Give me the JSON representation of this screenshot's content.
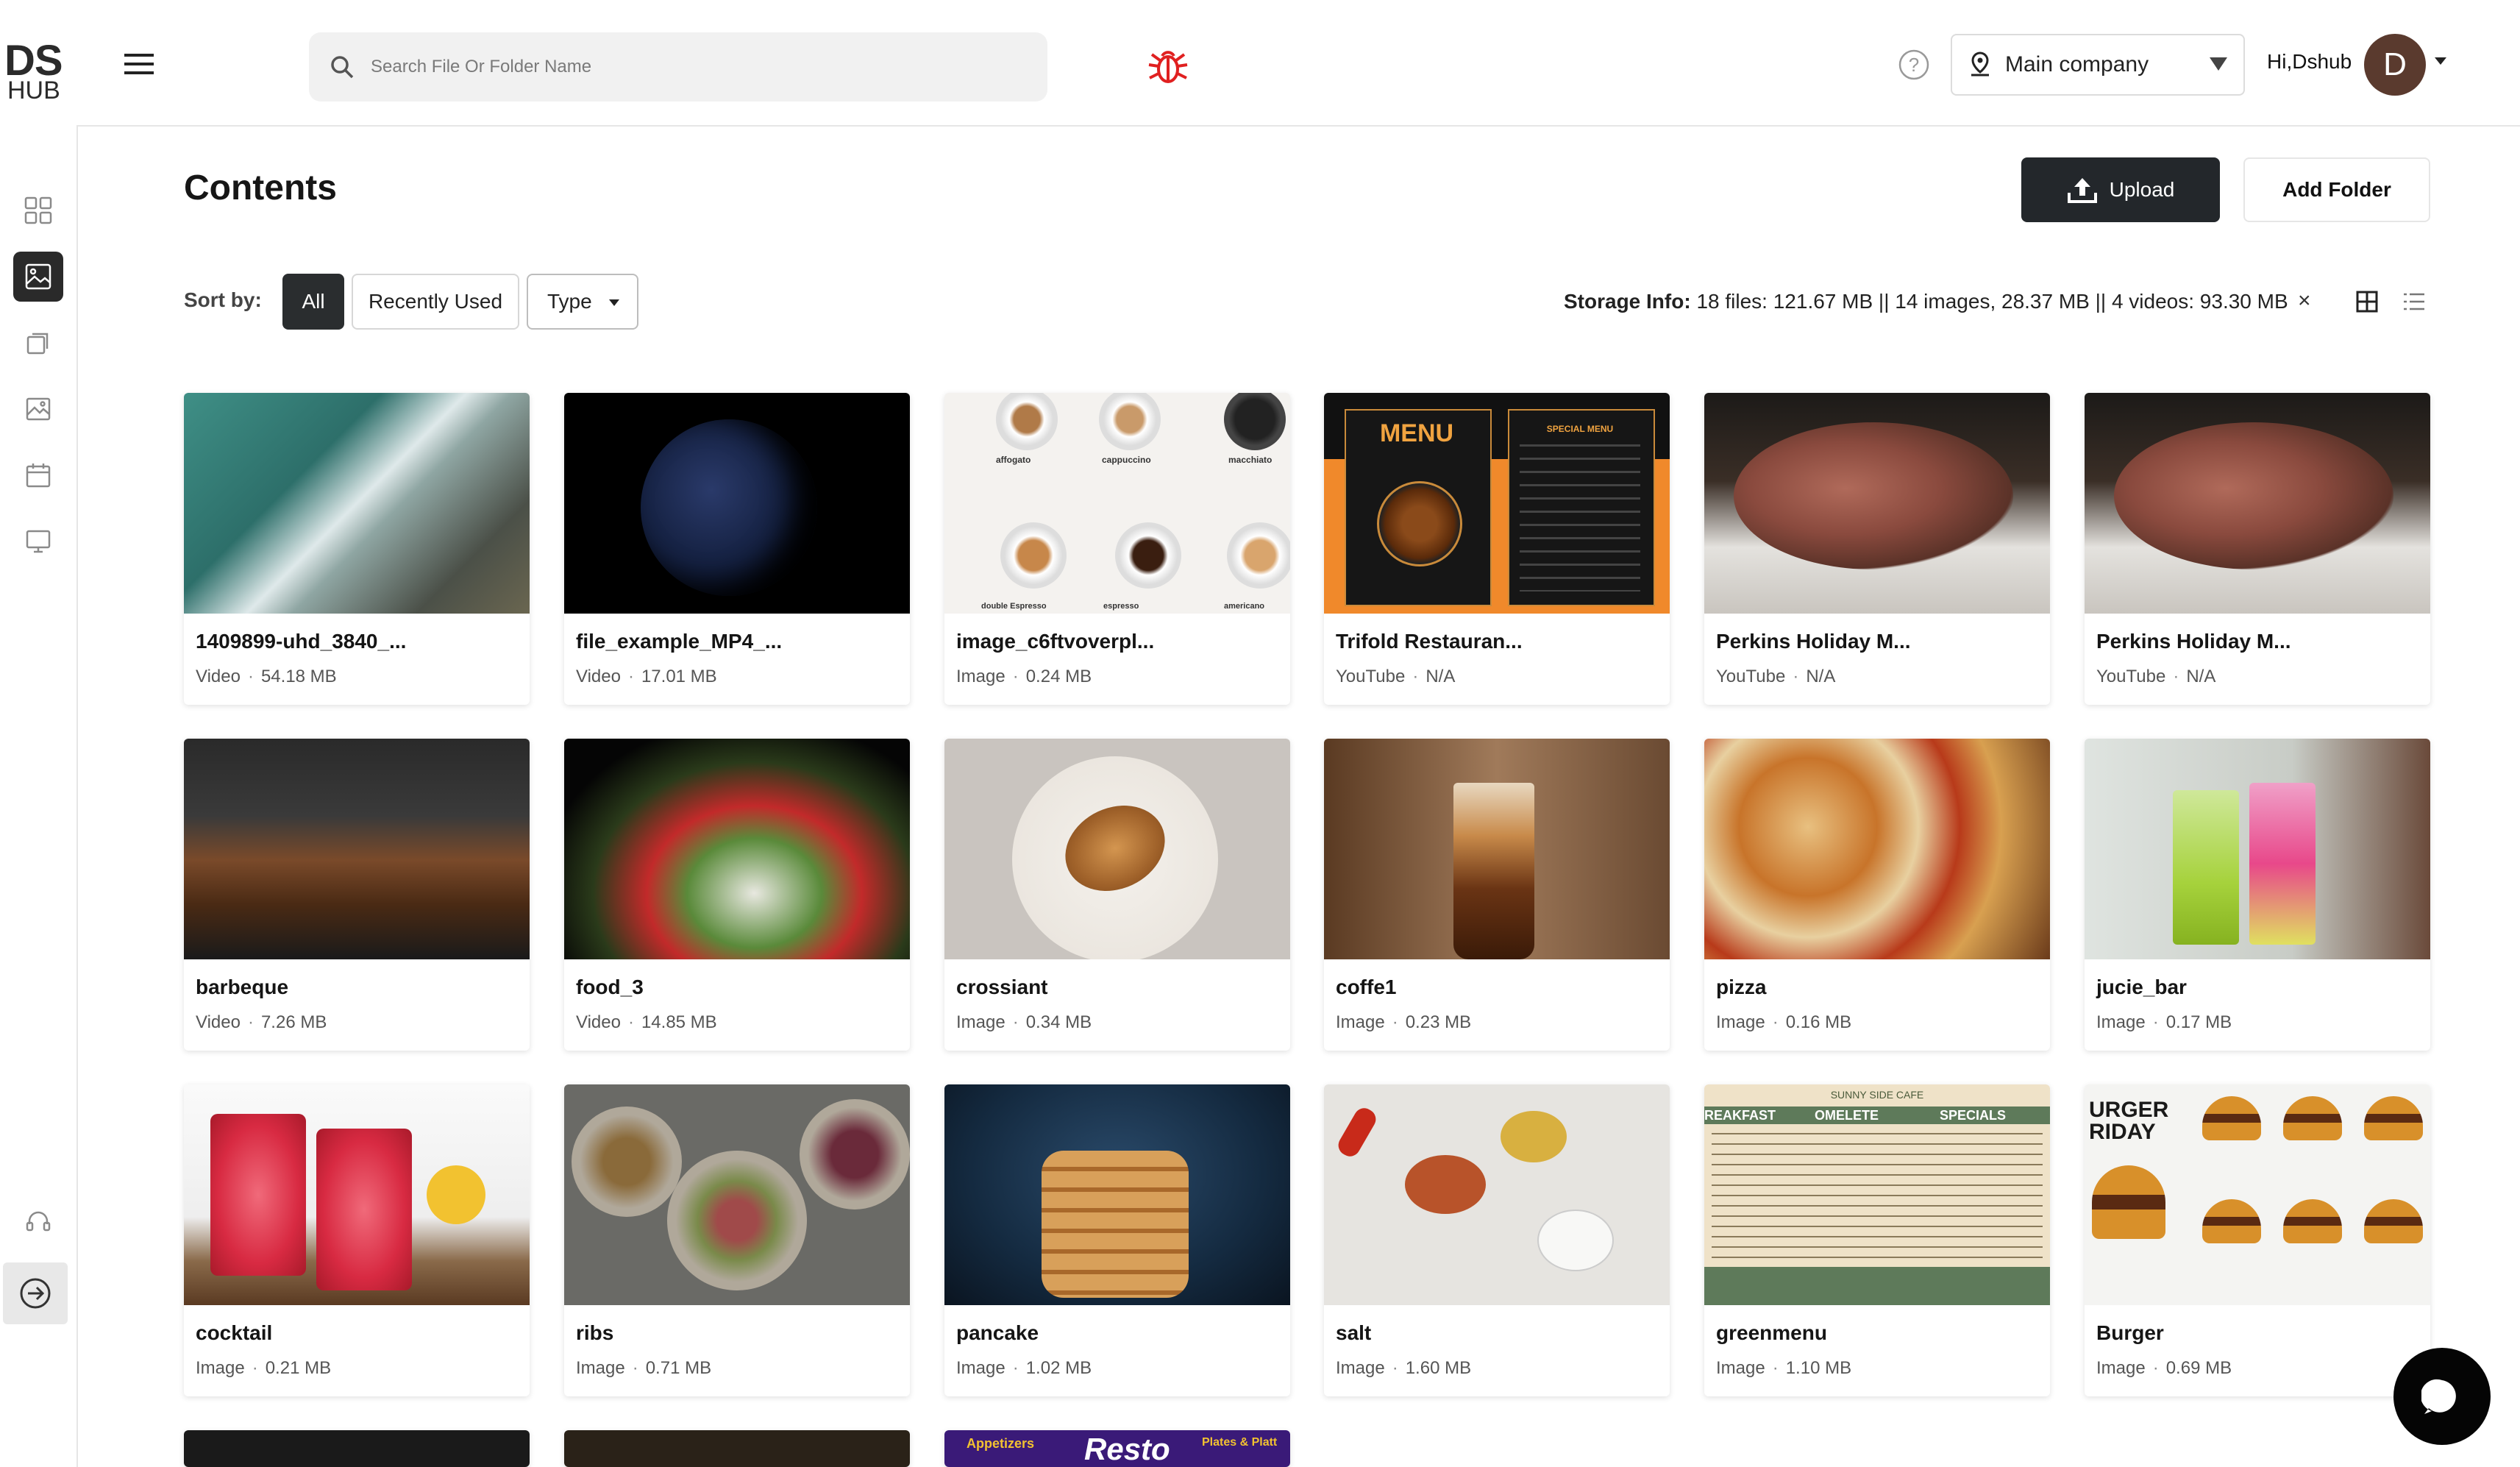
{
  "logo": {
    "top": "DS",
    "bottom": "HUB"
  },
  "search": {
    "placeholder": "Search File Or Folder Name"
  },
  "company": {
    "label": "Main company"
  },
  "user": {
    "greeting": "Hi,Dshub",
    "initial": "D"
  },
  "page": {
    "title": "Contents",
    "upload_label": "Upload",
    "add_folder_label": "Add Folder"
  },
  "sort": {
    "label": "Sort by:",
    "all": "All",
    "recent": "Recently Used",
    "type": "Type"
  },
  "storage": {
    "label": "Storage Info:",
    "value": " 18 files: 121.67 MB || 14 images, 28.37 MB || 4 videos: 93.30 MB",
    "close": "×"
  },
  "colors": {
    "accent": "#23272b",
    "bug": "#e02020"
  },
  "cards": [
    {
      "name": "1409899-uhd_3840_...",
      "type": "Video",
      "size": "54.18 MB"
    },
    {
      "name": "file_example_MP4_...",
      "type": "Video",
      "size": "17.01 MB"
    },
    {
      "name": "image_c6ftvoverpl...",
      "type": "Image",
      "size": "0.24 MB"
    },
    {
      "name": "Trifold Restauran...",
      "type": "YouTube",
      "size": "N/A"
    },
    {
      "name": "Perkins Holiday M...",
      "type": "YouTube",
      "size": "N/A"
    },
    {
      "name": "Perkins Holiday M...",
      "type": "YouTube",
      "size": "N/A"
    },
    {
      "name": "barbeque",
      "type": "Video",
      "size": "7.26 MB"
    },
    {
      "name": "food_3",
      "type": "Video",
      "size": "14.85 MB"
    },
    {
      "name": "crossiant",
      "type": "Image",
      "size": "0.34 MB"
    },
    {
      "name": "coffe1",
      "type": "Image",
      "size": "0.23 MB"
    },
    {
      "name": "pizza",
      "type": "Image",
      "size": "0.16 MB"
    },
    {
      "name": "jucie_bar",
      "type": "Image",
      "size": "0.17 MB"
    },
    {
      "name": "cocktail",
      "type": "Image",
      "size": "0.21 MB"
    },
    {
      "name": "ribs",
      "type": "Image",
      "size": "0.71 MB"
    },
    {
      "name": "pancake",
      "type": "Image",
      "size": "1.02 MB"
    },
    {
      "name": "salt",
      "type": "Image",
      "size": "1.60 MB"
    },
    {
      "name": "greenmenu",
      "type": "Image",
      "size": "1.10 MB"
    },
    {
      "name": "Burger",
      "type": "Image",
      "size": "0.69 MB"
    }
  ],
  "thumb_text": {
    "menu_word": "MENU",
    "special": "SPECIAL MENU",
    "coffee_words": [
      "affogato",
      "cappuccino",
      "macchiato",
      "double Espresso",
      "espresso",
      "americano"
    ],
    "green_header": "SUNNY SIDE CAFE",
    "green_cols": [
      "REAKFAST",
      "OMELETE",
      "SPECIALS"
    ],
    "burger_title": "URGER RIDAY",
    "row4_texts": [
      "Appetizers",
      "Resto",
      "Plates & Platt"
    ]
  }
}
